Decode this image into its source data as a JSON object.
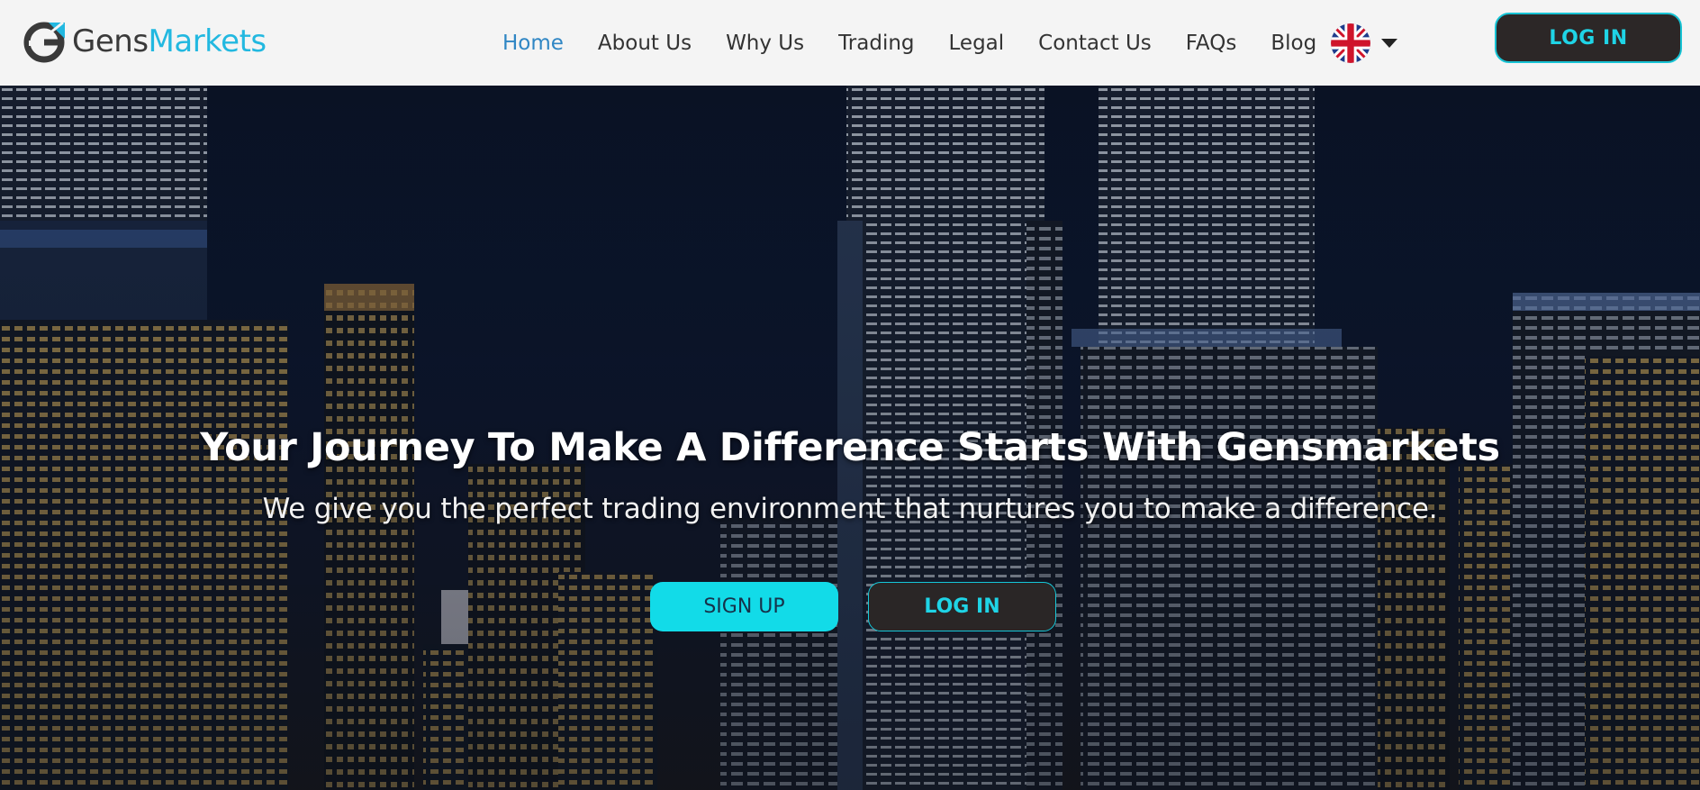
{
  "brand": {
    "name_part1": "Gens",
    "name_part2": "Markets",
    "accent_color": "#22b8e0"
  },
  "nav": {
    "items": [
      {
        "label": "Home",
        "active": true
      },
      {
        "label": "About Us"
      },
      {
        "label": "Why Us"
      },
      {
        "label": "Trading"
      },
      {
        "label": "Legal"
      },
      {
        "label": "Contact Us"
      },
      {
        "label": "FAQs"
      },
      {
        "label": "Blog"
      }
    ],
    "language_icon": "uk-flag-icon",
    "login_label": "LOG IN"
  },
  "hero": {
    "title": "Your Journey To Make A Difference Starts With Gensmarkets",
    "subtitle": "We give you the perfect trading environment that nurtures you to make a difference.",
    "signup_label": "SIGN UP",
    "login_label": "LOG IN"
  },
  "colors": {
    "cyan": "#12dbe8",
    "dark_button": "#2c2727",
    "active_nav": "#2f86c4"
  }
}
